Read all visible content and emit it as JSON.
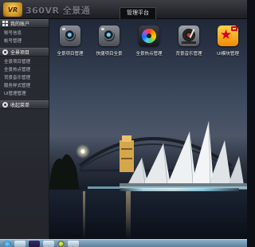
{
  "app": {
    "logo_text": "VR",
    "title": "360VR 全景通",
    "top_tab": "管理平台"
  },
  "sidebar": {
    "sections": [
      {
        "icon": "grid-icon",
        "label": "我的账户",
        "items": [
          {
            "label": "账号信息"
          },
          {
            "label": "帐号管理"
          }
        ]
      },
      {
        "icon": "settings-circle-icon",
        "label": "全景项目",
        "items": [
          {
            "label": "全景项目管理"
          },
          {
            "label": "全景热点管理"
          },
          {
            "label": "背景音乐管理"
          },
          {
            "label": "服务样式管理"
          },
          {
            "label": "UI管理管理"
          }
        ]
      },
      {
        "icon": "settings-circle-icon",
        "label": "收起菜单",
        "items": []
      }
    ]
  },
  "apps": [
    {
      "label": "全景项目管理",
      "icon": "camera-icon"
    },
    {
      "label": "快捷项目全景",
      "icon": "camera-icon"
    },
    {
      "label": "全景热点管理",
      "icon": "color-wheel-icon"
    },
    {
      "label": "背景音乐管理",
      "icon": "turntable-icon"
    },
    {
      "label": "UI模块管理",
      "icon": "star-icon"
    }
  ],
  "colors": {
    "topbar": "#2a2c31",
    "sidebar": "#26282e",
    "accent": "#ffd24a"
  }
}
